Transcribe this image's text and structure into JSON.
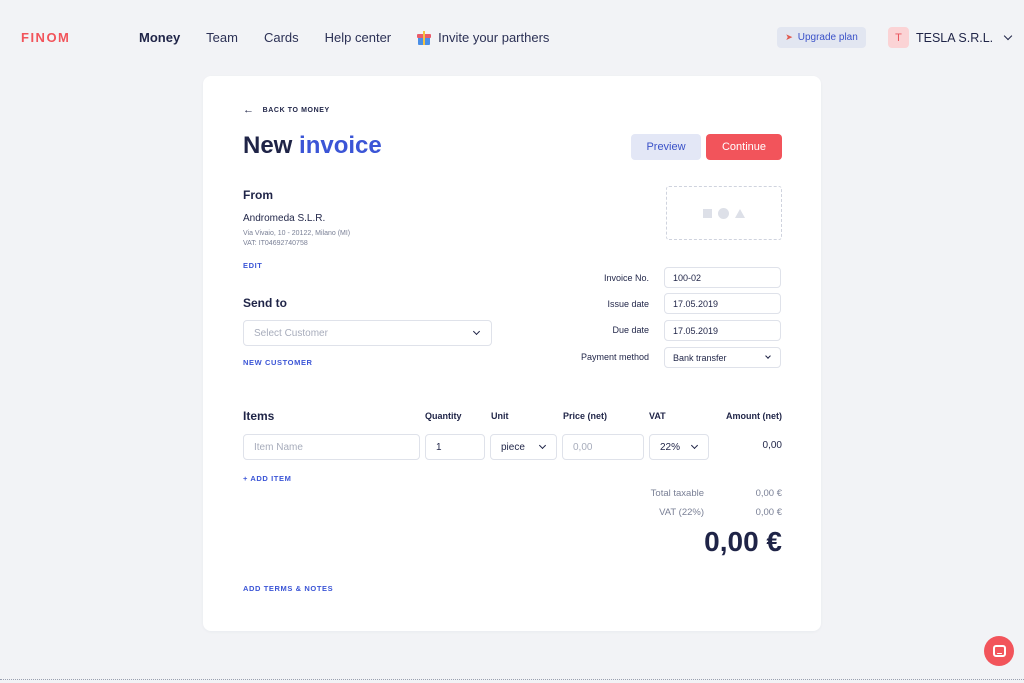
{
  "brand": {
    "logo": "FINOM",
    "accent_color": "#f2545b",
    "link_color": "#3b55d6"
  },
  "nav": {
    "items": [
      {
        "label": "Money",
        "active": true
      },
      {
        "label": "Team",
        "active": false
      },
      {
        "label": "Cards",
        "active": false
      },
      {
        "label": "Help center",
        "active": false
      }
    ],
    "invite_label": "Invite your parthers"
  },
  "header": {
    "upgrade_label": "Upgrade plan",
    "account": {
      "avatar_letter": "T",
      "name": "TESLA S.R.L."
    }
  },
  "page": {
    "back_label": "BACK TO MONEY",
    "title_part1": "New",
    "title_part2": "invoice",
    "preview_label": "Preview",
    "continue_label": "Continue"
  },
  "from": {
    "heading": "From",
    "company": "Andromeda S.L.R.",
    "address": "Via Vivaio, 10 - 20122, Milano (MI)",
    "vat": "VAT: IT04692740758",
    "edit_label": "EDIT"
  },
  "send_to": {
    "heading": "Send to",
    "placeholder": "Select Customer",
    "new_customer_label": "NEW CUSTOMER"
  },
  "invoice_meta": {
    "invoice_no": {
      "label": "Invoice No.",
      "value": "100-02"
    },
    "issue_date": {
      "label": "Issue date",
      "value": "17.05.2019"
    },
    "due_date": {
      "label": "Due date",
      "value": "17.05.2019"
    },
    "payment_method": {
      "label": "Payment method",
      "value": "Bank transfer"
    }
  },
  "items": {
    "heading": "Items",
    "columns": {
      "quantity": "Quantity",
      "unit": "Unit",
      "price": "Price (net)",
      "vat": "VAT",
      "amount": "Amount (net)"
    },
    "row": {
      "name_placeholder": "Item Name",
      "quantity": "1",
      "unit": "piece",
      "price_placeholder": "0,00",
      "vat": "22%",
      "amount": "0,00"
    },
    "add_item_label": "+ ADD ITEM"
  },
  "totals": {
    "taxable_label": "Total taxable",
    "taxable_value": "0,00 €",
    "vat_label": "VAT (22%)",
    "vat_value": "0,00 €",
    "grand_total": "0,00 €"
  },
  "terms_label": "ADD TERMS & NOTES"
}
